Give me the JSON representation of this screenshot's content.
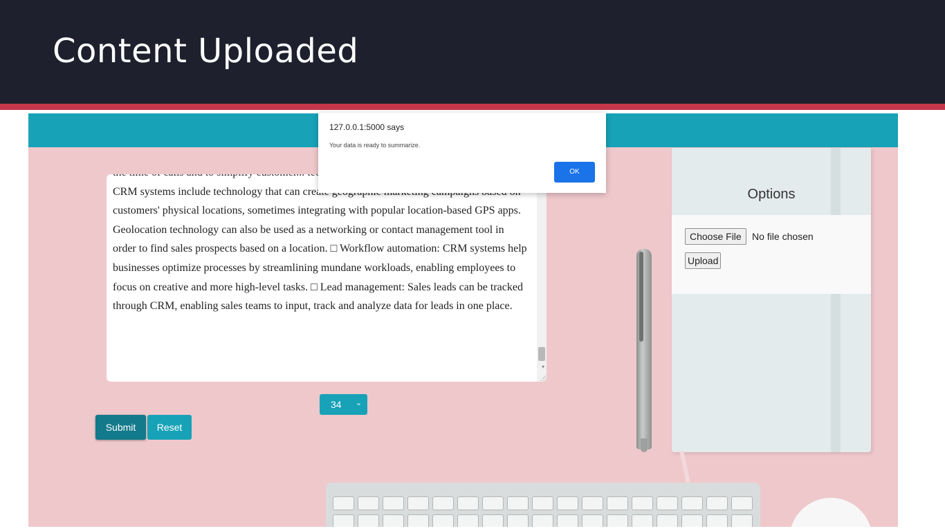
{
  "slide": {
    "title": "Content Uploaded"
  },
  "textarea": {
    "text": "the time of calls and to simplify customer... technology, or location-based services: Some CRM systems include technology that can create geographic marketing campaigns based on customers' physical locations, sometimes integrating with popular location-based GPS apps. Geolocation technology can also be used as a networking or contact management tool in order to find sales prospects based on a location. □ Workflow automation: CRM systems help businesses optimize processes by streamlining mundane workloads, enabling employees to focus on creative and more high-level tasks. □ Lead management: Sales leads can be tracked through CRM, enabling sales teams to input, track and analyze data for leads in one place."
  },
  "select": {
    "value": "34",
    "icon": "chevron-down-icon"
  },
  "buttons": {
    "submit": "Submit",
    "reset": "Reset"
  },
  "options": {
    "title": "Options",
    "choose_file": "Choose File",
    "file_status": "No file chosen",
    "upload": "Upload"
  },
  "alert": {
    "origin": "127.0.0.1:5000 says",
    "message": "Your data is ready to summarize.",
    "ok": "OK"
  },
  "colors": {
    "header_bg": "#1e212d",
    "accent_red": "#c4374b",
    "teal": "#18a2b8",
    "dark_teal": "#127a8a",
    "pink_bg": "#efc8cc",
    "alert_blue": "#1a73e8"
  }
}
